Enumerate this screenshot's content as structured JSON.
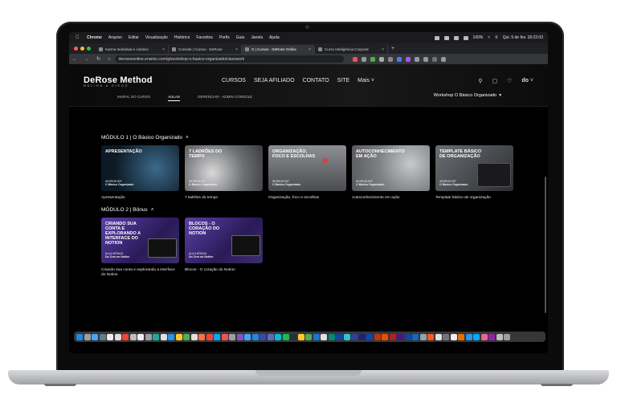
{
  "menubar": {
    "app": "Chrome",
    "items": [
      "Arquivo",
      "Editar",
      "Visualização",
      "Histórico",
      "Favoritos",
      "Perfis",
      "Guia",
      "Janela",
      "Ajuda"
    ],
    "battery": "100%",
    "datetime": "Qui. 5 de fev. 18:22:03"
  },
  "browser": {
    "tabs": [
      {
        "label": "Karma Individual e coletivo"
      },
      {
        "label": "Console | Cursos - DeRose"
      },
      {
        "label": "G | Cursos - DeRose Online"
      },
      {
        "label": "Curso Inteligência Corporal"
      }
    ],
    "url": "derosseonline.ensinio.com/g/workshop-o-basico-organizado/classwork"
  },
  "site": {
    "logo_main": "DeRose Method",
    "logo_sub": "MELINA & DIEGO",
    "nav": [
      "CURSOS",
      "SEJA AFILIADO",
      "CONTATO",
      "SITE",
      "Mais"
    ],
    "avatar_initials": "do",
    "subnav": [
      "MURAL DO CURSO",
      "AULAS",
      "GERENCIAR - ADMIN CONSOLE"
    ],
    "workshop_title": "Workshop O Básico Organizado"
  },
  "modules": [
    {
      "title": "MÓDULO 1 | O Básico Organizado",
      "lessons": [
        {
          "thumb_title": "APRESENTAÇÃO",
          "tag": "WORKSHOP",
          "tag2": "O Básico Organizado",
          "caption": "Apresentação",
          "color": "#1d3b52"
        },
        {
          "thumb_title": "7 LADRÕES DO TEMPO",
          "tag": "WORKSHOP",
          "tag2": "O Básico Organizado",
          "caption": "7 ladrões do tempo",
          "color": "#5a5d62"
        },
        {
          "thumb_title": "ORGANIZAÇÃO, FOCO E ESCOLHAS",
          "tag": "WORKSHOP",
          "tag2": "O Básico Organizado",
          "caption": "Organização, foco e escolhas",
          "color": "#6a6c70"
        },
        {
          "thumb_title": "AUTOCONHECIMENTO EM AÇÃO",
          "tag": "WORKSHOP",
          "tag2": "O Básico Organizado",
          "caption": "Autoconhecimento em ação",
          "color": "#8a8c90"
        },
        {
          "thumb_title": "TEMPLATE BÁSICO DE ORGANIZAÇÃO",
          "tag": "WORKSHOP",
          "tag2": "O Básico Organizado",
          "caption": "Template básico de organização",
          "color": "#3c3f44"
        }
      ]
    },
    {
      "title": "MÓDULO 2 | Bônus",
      "lessons": [
        {
          "thumb_title": "CRIANDO SUA CONTA E EXPLORANDO A INTERFACE DO NOTION",
          "tag": "AULA BÔNUS",
          "tag2": "Do Zero ao Notion",
          "caption": "Criando sua conta e explorando a interface do Notion",
          "color": "#3a2a6a"
        },
        {
          "thumb_title": "BLOCOS - O CORAÇÃO DO NOTION",
          "tag": "AULA BÔNUS",
          "tag2": "Do Zero ao Notion",
          "caption": "Blocos - O coração do Notion",
          "color": "#3a2a6a"
        }
      ]
    }
  ]
}
